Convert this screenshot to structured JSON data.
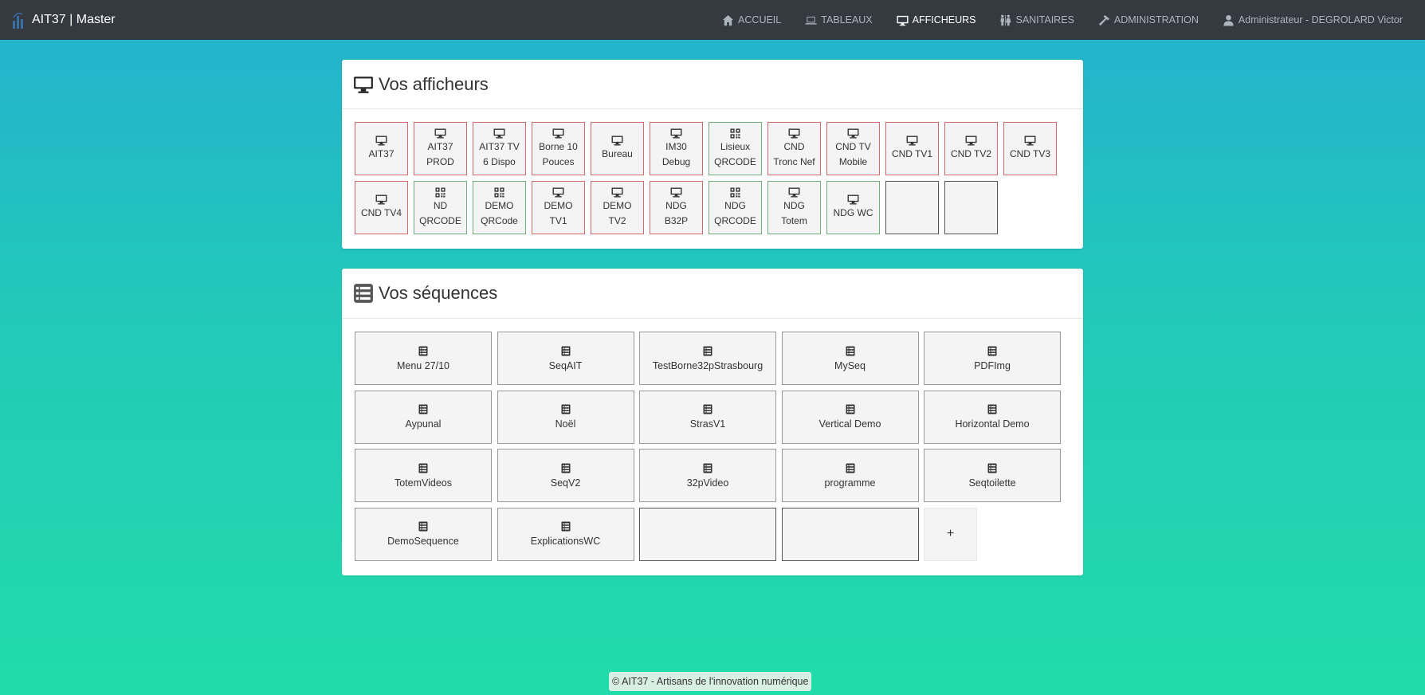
{
  "app": {
    "title": "AIT37 | Master"
  },
  "nav": {
    "items": [
      {
        "label": "ACCUEIL",
        "icon": "home-icon"
      },
      {
        "label": "TABLEAUX",
        "icon": "laptop-icon"
      },
      {
        "label": "AFFICHEURS",
        "icon": "monitor-icon",
        "active": true
      },
      {
        "label": "SANITAIRES",
        "icon": "restroom-icon"
      },
      {
        "label": "ADMINISTRATION",
        "icon": "hammer-icon"
      },
      {
        "label": "Administrateur - DEGROLARD Victor",
        "icon": "user-icon"
      }
    ]
  },
  "afficheurs": {
    "title": "Vos afficheurs",
    "items": [
      {
        "label": "AIT37",
        "type": "screen",
        "status": "red"
      },
      {
        "label": "AIT37 PROD",
        "type": "screen",
        "status": "red"
      },
      {
        "label": "AIT37 TV 6 Dispo",
        "type": "screen",
        "status": "red"
      },
      {
        "label": "Borne 10 Pouces",
        "type": "screen",
        "status": "red"
      },
      {
        "label": "Bureau",
        "type": "screen",
        "status": "red"
      },
      {
        "label": "IM30 Debug",
        "type": "screen",
        "status": "red"
      },
      {
        "label": "Lisieux QRCODE",
        "type": "qrcode",
        "status": "green"
      },
      {
        "label": "CND Tronc Nef",
        "type": "screen",
        "status": "red"
      },
      {
        "label": "CND TV Mobile",
        "type": "screen",
        "status": "red"
      },
      {
        "label": "CND TV1",
        "type": "screen",
        "status": "red"
      },
      {
        "label": "CND TV2",
        "type": "screen",
        "status": "red"
      },
      {
        "label": "CND TV3",
        "type": "screen",
        "status": "red"
      },
      {
        "label": "CND TV4",
        "type": "screen",
        "status": "red"
      },
      {
        "label": "ND QRCODE",
        "type": "qrcode",
        "status": "green"
      },
      {
        "label": "DEMO QRCode",
        "type": "qrcode",
        "status": "green"
      },
      {
        "label": "DEMO TV1",
        "type": "screen",
        "status": "red"
      },
      {
        "label": "DEMO TV2",
        "type": "screen",
        "status": "red"
      },
      {
        "label": "NDG B32P",
        "type": "screen",
        "status": "red"
      },
      {
        "label": "NDG QRCODE",
        "type": "qrcode",
        "status": "green"
      },
      {
        "label": "NDG Totem",
        "type": "screen",
        "status": "green"
      },
      {
        "label": "NDG WC",
        "type": "screen",
        "status": "green"
      },
      {
        "label": "",
        "type": "empty",
        "status": "empty"
      },
      {
        "label": "",
        "type": "empty",
        "status": "empty"
      }
    ]
  },
  "sequences": {
    "title": "Vos séquences",
    "items": [
      {
        "label": "Menu 27/10"
      },
      {
        "label": "SeqAIT"
      },
      {
        "label": "TestBorne32pStrasbourg"
      },
      {
        "label": "MySeq"
      },
      {
        "label": "PDFImg"
      },
      {
        "label": "Aypunal"
      },
      {
        "label": "Noël"
      },
      {
        "label": "StrasV1"
      },
      {
        "label": "Vertical Demo"
      },
      {
        "label": "Horizontal Demo"
      },
      {
        "label": "TotemVideos"
      },
      {
        "label": "SeqV2"
      },
      {
        "label": "32pVideo"
      },
      {
        "label": "programme"
      },
      {
        "label": "Seqtoilette"
      },
      {
        "label": "DemoSequence"
      },
      {
        "label": "ExplicationsWC"
      },
      {
        "label": "",
        "empty": true
      },
      {
        "label": "",
        "empty": true
      }
    ],
    "add_label": "+"
  },
  "footer": {
    "text": "© AIT37 - Artisans de l'innovation numérique"
  }
}
